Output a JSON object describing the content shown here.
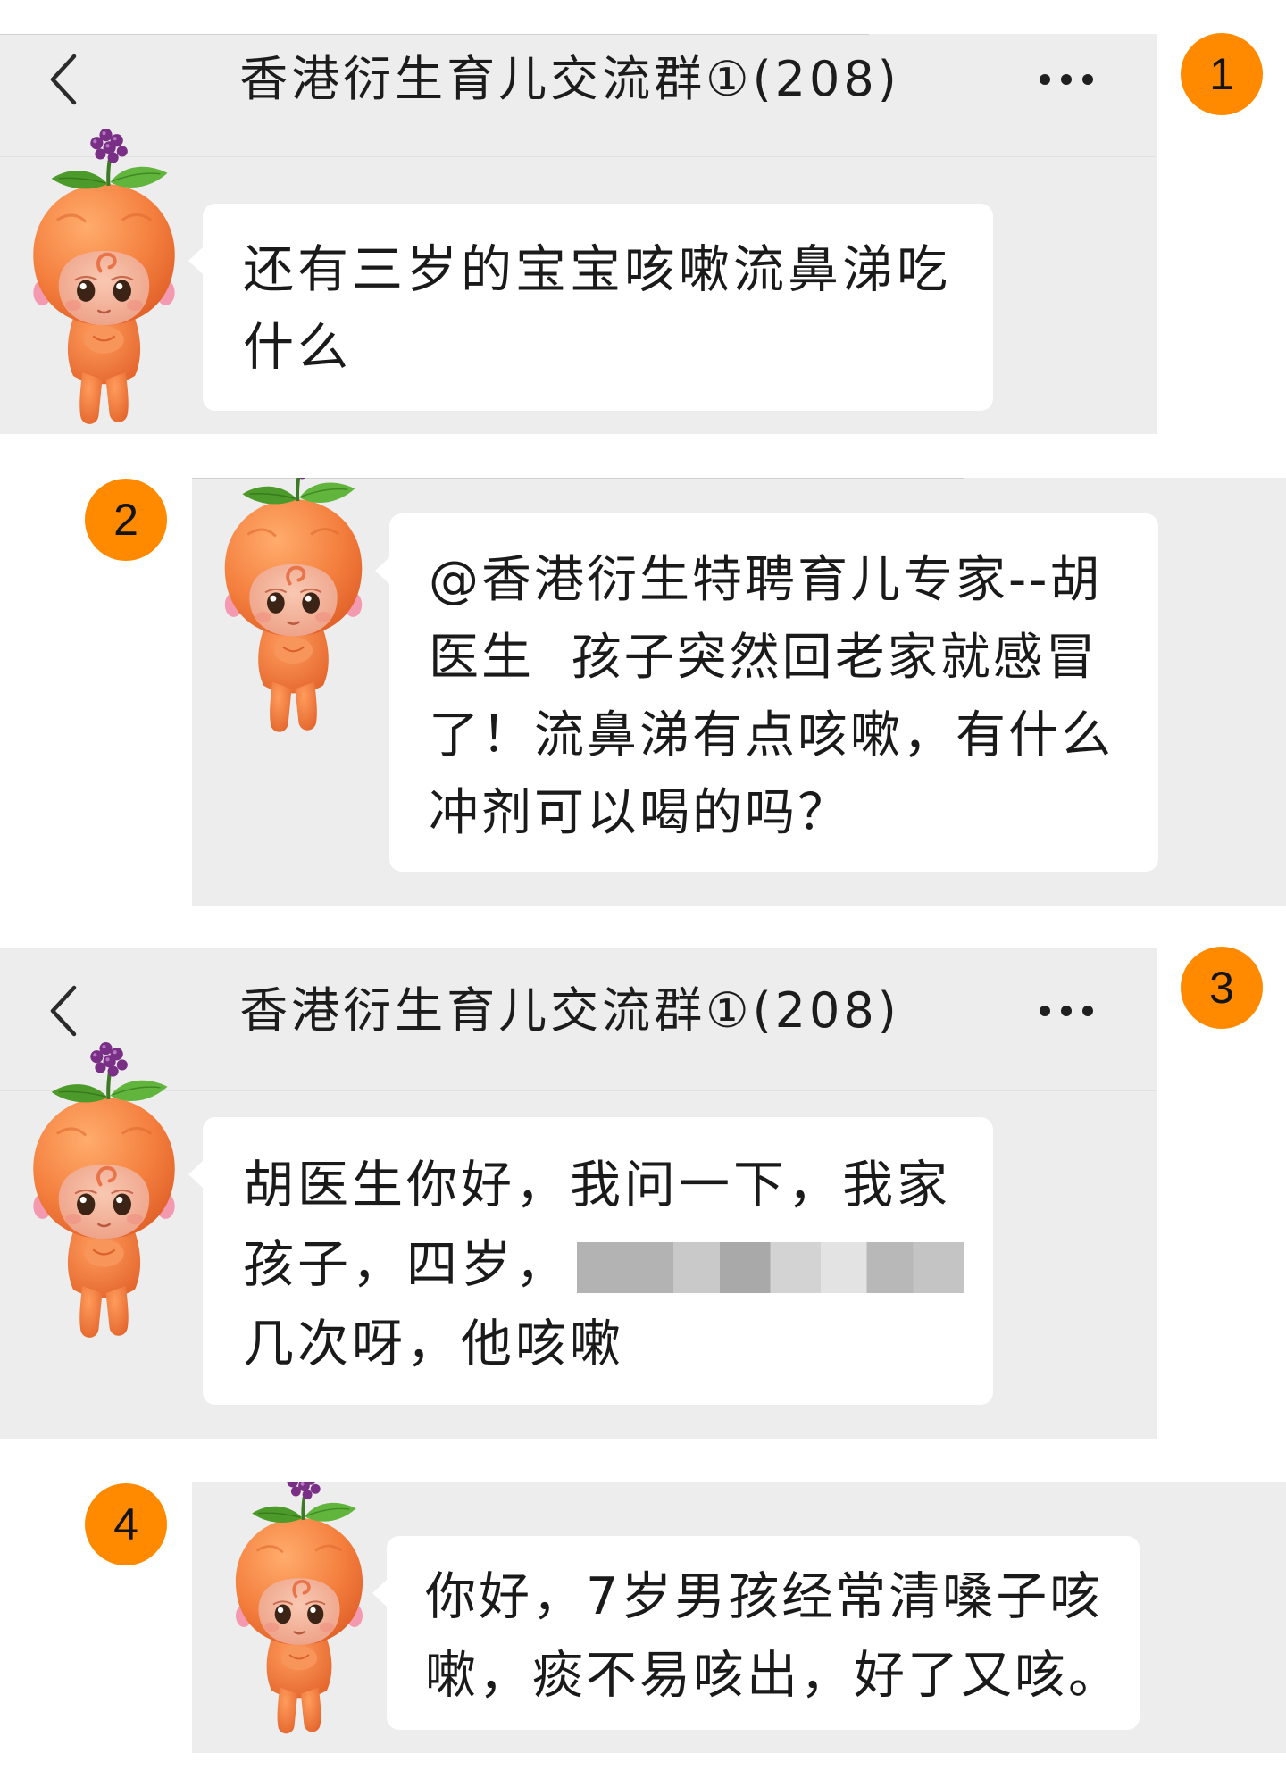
{
  "colors": {
    "panel_bg": "#ededed",
    "bubble_bg": "#ffffff",
    "badge": "#ff8a00",
    "text": "#1a1a1a"
  },
  "screens": [
    {
      "badge": "1",
      "header": {
        "title": "香港衍生育儿交流群①(208)",
        "back_icon": "chevron-left-icon",
        "more_icon": "more-dots-icon"
      },
      "avatar_icon": "orange-kid-avatar",
      "message": {
        "lines": [
          "还有三岁的宝宝咳嗽流鼻涕吃",
          "什么"
        ]
      }
    },
    {
      "badge": "2",
      "avatar_icon": "orange-kid-avatar",
      "message": {
        "lines": [
          "@香港衍生特聘育儿专家--胡",
          "医生  孩子突然回老家就感冒",
          "了！流鼻涕有点咳嗽，有什么",
          "冲剂可以喝的吗？"
        ]
      }
    },
    {
      "badge": "3",
      "header": {
        "title": "香港衍生育儿交流群①(208)",
        "back_icon": "chevron-left-icon",
        "more_icon": "more-dots-icon"
      },
      "avatar_icon": "orange-kid-avatar",
      "message": {
        "lines": [
          "胡医生你好，我问一下，我家",
          "孩子，四岁，",
          "几次呀，他咳嗽"
        ]
      }
    },
    {
      "badge": "4",
      "avatar_icon": "orange-kid-avatar",
      "message": {
        "lines": [
          "你好，7岁男孩经常清嗓子咳",
          "嗽，痰不易咳出，好了又咳。"
        ]
      }
    }
  ]
}
